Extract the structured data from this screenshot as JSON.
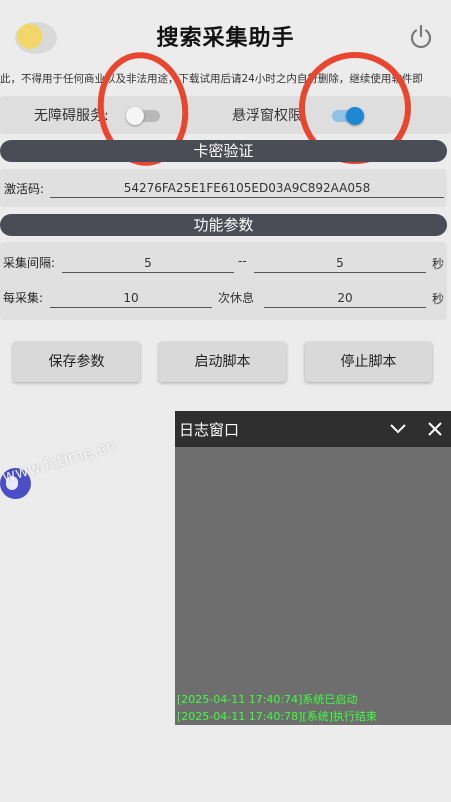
{
  "header": {
    "title": "搜索采集助手"
  },
  "disclaimer": "此，不得用于任何商业以及非法用途，下载试用后请24小时之内自行删除，继续使用软件即",
  "permissions": {
    "accessibility": {
      "label": "无障碍服务:",
      "enabled": false
    },
    "overlay": {
      "label": "悬浮窗权限:",
      "enabled": true
    }
  },
  "colors": {
    "accent": "#1e88d4",
    "annotation": "#e8462f",
    "log_text": "#3cff3c"
  },
  "activation": {
    "section_title": "卡密验证",
    "label": "激活码:",
    "value": "54276FA25E1FE6105ED03A9C892AA058"
  },
  "params": {
    "section_title": "功能参数",
    "interval": {
      "label": "采集间隔:",
      "min": "5",
      "separator": "--",
      "max": "5",
      "unit": "秒"
    },
    "rest": {
      "label": "每采集:",
      "count": "10",
      "middle": "次休息",
      "seconds": "20",
      "unit": "秒"
    }
  },
  "buttons": {
    "save": "保存参数",
    "start": "启动脚本",
    "stop": "停止脚本"
  },
  "log": {
    "title": "日志窗口",
    "lines": [
      "[2025-04-11 17:40:74]系统已启动",
      "[2025-04-11 17:40:78][系统]执行结束"
    ]
  },
  "watermark": "www.fctime.cn",
  "icons": {
    "header_left": "avatar-icon",
    "header_right": "power-icon",
    "log_collapse": "chevron-down-icon",
    "log_close": "close-icon"
  }
}
